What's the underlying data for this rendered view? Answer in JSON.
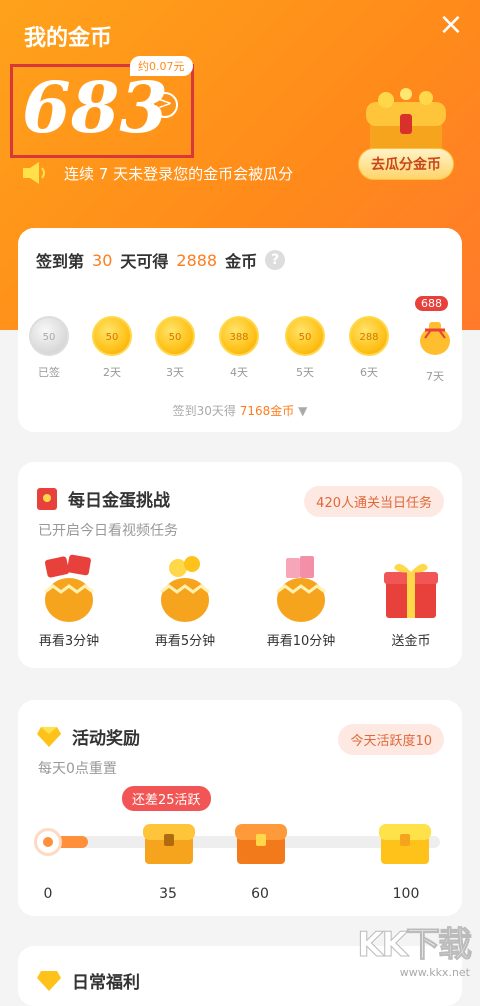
{
  "header": {
    "title": "我的金币",
    "close_symbol": "×",
    "approx_label": "约0.07元",
    "coins": "683",
    "detail_symbol": ">",
    "divide_button": "去瓜分金币",
    "warning": "连续 7 天未登录您的金币会被瓜分"
  },
  "signin": {
    "prefix": "签到第",
    "day_count": "30",
    "middle": "天可得",
    "reward": "2888",
    "suffix": "金币",
    "help_symbol": "?",
    "days": [
      {
        "value": "50",
        "label": "已签",
        "signed": true
      },
      {
        "value": "50",
        "label": "2天"
      },
      {
        "value": "50",
        "label": "3天"
      },
      {
        "value": "388",
        "label": "4天"
      },
      {
        "value": "50",
        "label": "5天"
      },
      {
        "value": "288",
        "label": "6天"
      }
    ],
    "day7": {
      "badge": "688",
      "label": "7天"
    },
    "footer_prefix": "签到30天得",
    "footer_value": "7168金币",
    "footer_caret": "▼"
  },
  "challenge": {
    "title": "每日金蛋挑战",
    "subtitle": "已开启今日看视频任务",
    "pill": "420人通关当日任务",
    "items": [
      {
        "label": "再看3分钟"
      },
      {
        "label": "再看5分钟"
      },
      {
        "label": "再看10分钟"
      },
      {
        "label": "送金币"
      }
    ]
  },
  "activity": {
    "title": "活动奖励",
    "subtitle": "每天0点重置",
    "pill": "今天活跃度10",
    "remaining": "还差25活跃",
    "progress_fraction": 0.12,
    "milestones": [
      "0",
      "35",
      "60",
      "100"
    ]
  },
  "daily": {
    "title": "日常福利"
  },
  "watermark": {
    "logo": "KK下载",
    "url": "www.kkx.net"
  },
  "colors": {
    "hero_orange": "#ff8c1a",
    "accent": "#ff7d1f",
    "highlight_box": "#d9383a"
  }
}
